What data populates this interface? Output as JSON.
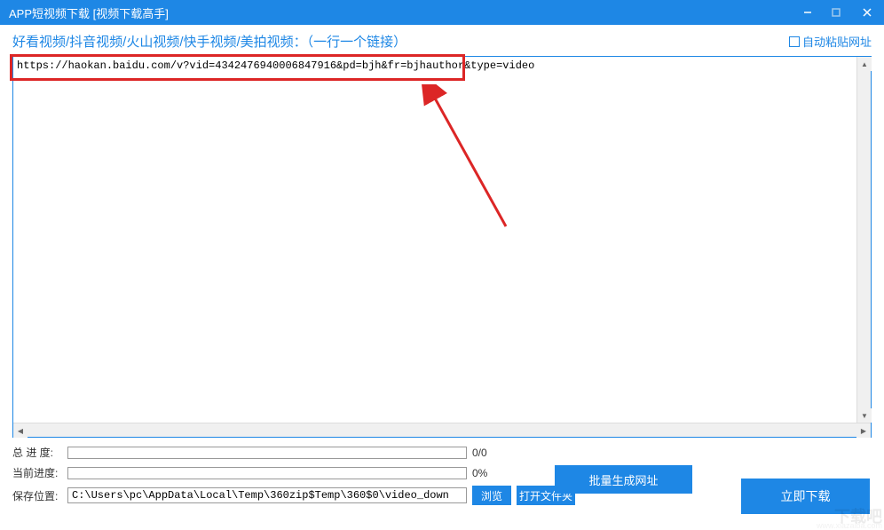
{
  "titlebar": {
    "title": "APP短视频下载 [视频下载高手]"
  },
  "header": {
    "label": "好看视频/抖音视频/火山视频/快手视频/美拍视频：（一行一个链接）",
    "autopaste_label": "自动粘贴网址"
  },
  "url_content": "https://haokan.baidu.com/v?vid=4342476940006847916&pd=bjh&fr=bjhauthor&type=video",
  "progress": {
    "total_label": "总 进 度:",
    "total_value": "0/0",
    "current_label": "当前进度:",
    "current_value": "0%"
  },
  "save": {
    "label": "保存位置:",
    "path": "C:\\Users\\pc\\AppData\\Local\\Temp\\360zip$Temp\\360$0\\video_down"
  },
  "buttons": {
    "batch": "批量生成网址",
    "download": "立即下载",
    "browse": "浏览",
    "open_folder": "打开文件夹"
  },
  "watermark": {
    "main": "下载吧",
    "sub": "www.xiazaiba.com"
  }
}
